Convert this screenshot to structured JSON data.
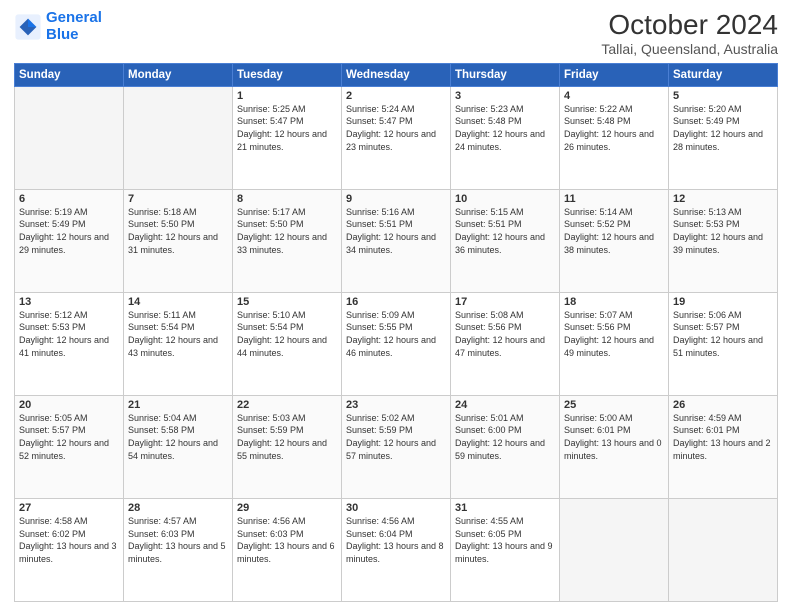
{
  "header": {
    "logo_line1": "General",
    "logo_line2": "Blue",
    "month": "October 2024",
    "location": "Tallai, Queensland, Australia"
  },
  "weekdays": [
    "Sunday",
    "Monday",
    "Tuesday",
    "Wednesday",
    "Thursday",
    "Friday",
    "Saturday"
  ],
  "weeks": [
    [
      {
        "day": "",
        "empty": true
      },
      {
        "day": "",
        "empty": true
      },
      {
        "day": "1",
        "sunrise": "5:25 AM",
        "sunset": "5:47 PM",
        "daylight": "12 hours and 21 minutes."
      },
      {
        "day": "2",
        "sunrise": "5:24 AM",
        "sunset": "5:47 PM",
        "daylight": "12 hours and 23 minutes."
      },
      {
        "day": "3",
        "sunrise": "5:23 AM",
        "sunset": "5:48 PM",
        "daylight": "12 hours and 24 minutes."
      },
      {
        "day": "4",
        "sunrise": "5:22 AM",
        "sunset": "5:48 PM",
        "daylight": "12 hours and 26 minutes."
      },
      {
        "day": "5",
        "sunrise": "5:20 AM",
        "sunset": "5:49 PM",
        "daylight": "12 hours and 28 minutes."
      }
    ],
    [
      {
        "day": "6",
        "sunrise": "5:19 AM",
        "sunset": "5:49 PM",
        "daylight": "12 hours and 29 minutes."
      },
      {
        "day": "7",
        "sunrise": "5:18 AM",
        "sunset": "5:50 PM",
        "daylight": "12 hours and 31 minutes."
      },
      {
        "day": "8",
        "sunrise": "5:17 AM",
        "sunset": "5:50 PM",
        "daylight": "12 hours and 33 minutes."
      },
      {
        "day": "9",
        "sunrise": "5:16 AM",
        "sunset": "5:51 PM",
        "daylight": "12 hours and 34 minutes."
      },
      {
        "day": "10",
        "sunrise": "5:15 AM",
        "sunset": "5:51 PM",
        "daylight": "12 hours and 36 minutes."
      },
      {
        "day": "11",
        "sunrise": "5:14 AM",
        "sunset": "5:52 PM",
        "daylight": "12 hours and 38 minutes."
      },
      {
        "day": "12",
        "sunrise": "5:13 AM",
        "sunset": "5:53 PM",
        "daylight": "12 hours and 39 minutes."
      }
    ],
    [
      {
        "day": "13",
        "sunrise": "5:12 AM",
        "sunset": "5:53 PM",
        "daylight": "12 hours and 41 minutes."
      },
      {
        "day": "14",
        "sunrise": "5:11 AM",
        "sunset": "5:54 PM",
        "daylight": "12 hours and 43 minutes."
      },
      {
        "day": "15",
        "sunrise": "5:10 AM",
        "sunset": "5:54 PM",
        "daylight": "12 hours and 44 minutes."
      },
      {
        "day": "16",
        "sunrise": "5:09 AM",
        "sunset": "5:55 PM",
        "daylight": "12 hours and 46 minutes."
      },
      {
        "day": "17",
        "sunrise": "5:08 AM",
        "sunset": "5:56 PM",
        "daylight": "12 hours and 47 minutes."
      },
      {
        "day": "18",
        "sunrise": "5:07 AM",
        "sunset": "5:56 PM",
        "daylight": "12 hours and 49 minutes."
      },
      {
        "day": "19",
        "sunrise": "5:06 AM",
        "sunset": "5:57 PM",
        "daylight": "12 hours and 51 minutes."
      }
    ],
    [
      {
        "day": "20",
        "sunrise": "5:05 AM",
        "sunset": "5:57 PM",
        "daylight": "12 hours and 52 minutes."
      },
      {
        "day": "21",
        "sunrise": "5:04 AM",
        "sunset": "5:58 PM",
        "daylight": "12 hours and 54 minutes."
      },
      {
        "day": "22",
        "sunrise": "5:03 AM",
        "sunset": "5:59 PM",
        "daylight": "12 hours and 55 minutes."
      },
      {
        "day": "23",
        "sunrise": "5:02 AM",
        "sunset": "5:59 PM",
        "daylight": "12 hours and 57 minutes."
      },
      {
        "day": "24",
        "sunrise": "5:01 AM",
        "sunset": "6:00 PM",
        "daylight": "12 hours and 59 minutes."
      },
      {
        "day": "25",
        "sunrise": "5:00 AM",
        "sunset": "6:01 PM",
        "daylight": "13 hours and 0 minutes."
      },
      {
        "day": "26",
        "sunrise": "4:59 AM",
        "sunset": "6:01 PM",
        "daylight": "13 hours and 2 minutes."
      }
    ],
    [
      {
        "day": "27",
        "sunrise": "4:58 AM",
        "sunset": "6:02 PM",
        "daylight": "13 hours and 3 minutes."
      },
      {
        "day": "28",
        "sunrise": "4:57 AM",
        "sunset": "6:03 PM",
        "daylight": "13 hours and 5 minutes."
      },
      {
        "day": "29",
        "sunrise": "4:56 AM",
        "sunset": "6:03 PM",
        "daylight": "13 hours and 6 minutes."
      },
      {
        "day": "30",
        "sunrise": "4:56 AM",
        "sunset": "6:04 PM",
        "daylight": "13 hours and 8 minutes."
      },
      {
        "day": "31",
        "sunrise": "4:55 AM",
        "sunset": "6:05 PM",
        "daylight": "13 hours and 9 minutes."
      },
      {
        "day": "",
        "empty": true
      },
      {
        "day": "",
        "empty": true
      }
    ]
  ],
  "labels": {
    "sunrise": "Sunrise:",
    "sunset": "Sunset:",
    "daylight": "Daylight:"
  }
}
